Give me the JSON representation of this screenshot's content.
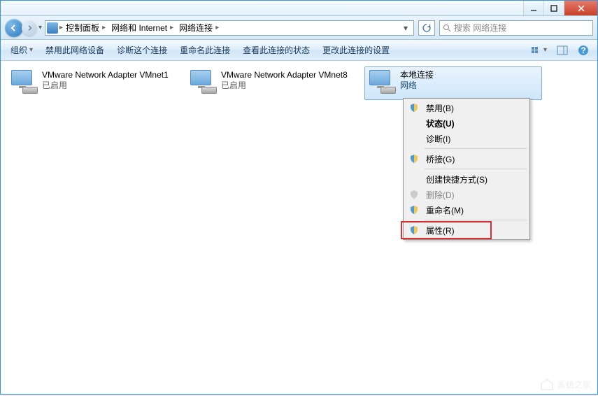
{
  "breadcrumbs": [
    "控制面板",
    "网络和 Internet",
    "网络连接"
  ],
  "search_placeholder": "搜索 网络连接",
  "toolbar": {
    "organize": "组织",
    "disable": "禁用此网络设备",
    "diagnose": "诊断这个连接",
    "rename": "重命名此连接",
    "status": "查看此连接的状态",
    "change": "更改此连接的设置"
  },
  "items": [
    {
      "name": "VMware Network Adapter VMnet1",
      "status": "已启用"
    },
    {
      "name": "VMware Network Adapter VMnet8",
      "status": "已启用"
    },
    {
      "name": "本地连接",
      "status": "网络"
    }
  ],
  "context_menu": {
    "disable": "禁用(B)",
    "status": "状态(U)",
    "diagnose": "诊断(I)",
    "bridge": "桥接(G)",
    "shortcut": "创建快捷方式(S)",
    "delete": "删除(D)",
    "rename": "重命名(M)",
    "properties": "属性(R)"
  },
  "watermark": "系统之家"
}
